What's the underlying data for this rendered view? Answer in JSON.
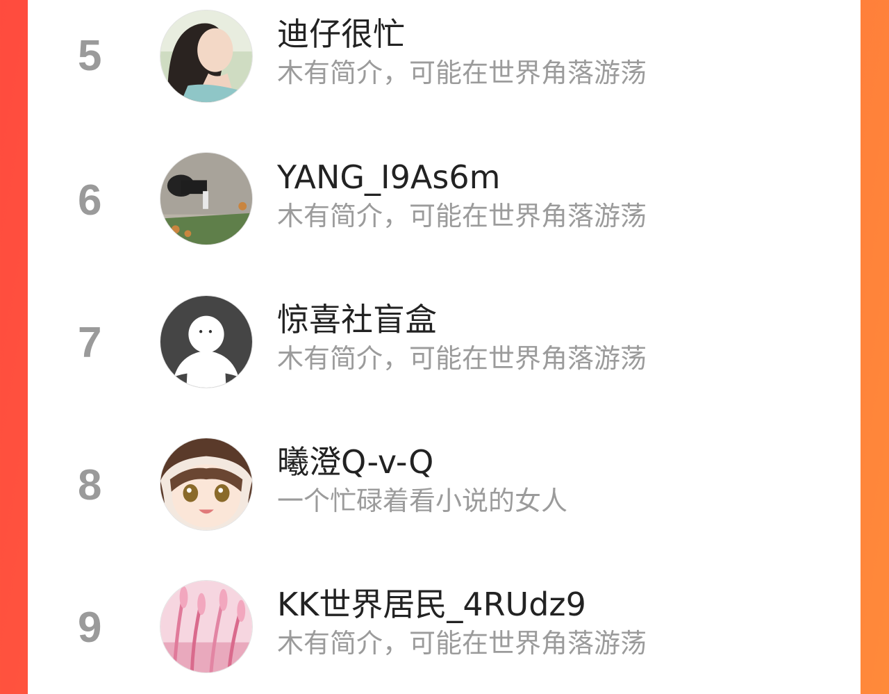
{
  "colors": {
    "background_gradient_start": "#ff4b3e",
    "background_gradient_end": "#ff8a3a",
    "panel": "#ffffff",
    "rank": "#9a9a9a",
    "name": "#222222",
    "bio": "#9b9b9b"
  },
  "ranking": {
    "items": [
      {
        "rank": "5",
        "name": "迪仔很忙",
        "bio": "木有简介，可能在世界角落游荡",
        "avatar": "woman-photo-avatar"
      },
      {
        "rank": "6",
        "name": "YANG_I9As6m",
        "bio": "木有简介，可能在世界角落游荡",
        "avatar": "outdoor-photo-avatar"
      },
      {
        "rank": "7",
        "name": "惊喜社盲盒",
        "bio": "木有简介，可能在世界角落游荡",
        "avatar": "default-user-avatar"
      },
      {
        "rank": "8",
        "name": "曦澄Q-v-Q",
        "bio": "一个忙碌着看小说的女人",
        "avatar": "anime-girl-avatar"
      },
      {
        "rank": "9",
        "name": "KK世界居民_4RUdz9",
        "bio": "木有简介，可能在世界角落游荡",
        "avatar": "pink-grass-avatar"
      }
    ]
  }
}
